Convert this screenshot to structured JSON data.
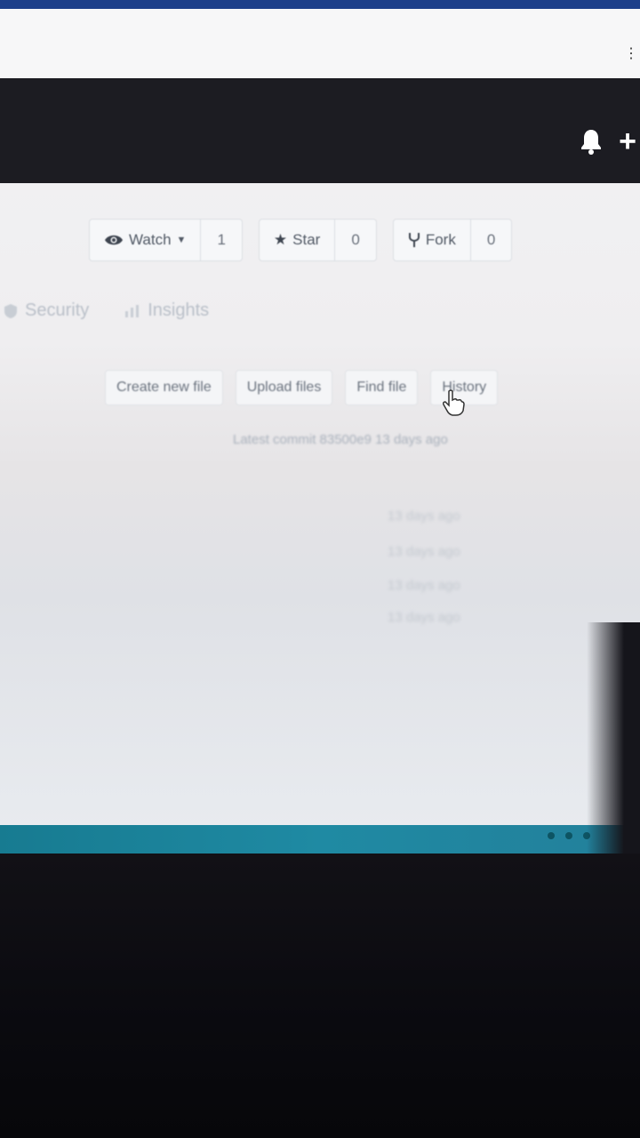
{
  "repo_actions": {
    "watch_label": "Watch",
    "watch_count": "1",
    "star_label": "Star",
    "star_count": "0",
    "fork_label": "Fork",
    "fork_count": "0"
  },
  "nav": {
    "tabs": [
      {
        "label": "Security",
        "icon": "shield-icon"
      },
      {
        "label": "Insights",
        "icon": "graph-icon"
      }
    ]
  },
  "file_actions": {
    "create_new_file": "Create new file",
    "upload_files": "Upload files",
    "find_file": "Find file",
    "history": "History"
  },
  "latest_commit": "Latest commit 83500e9 13 days ago",
  "commit_times": [
    "13 days ago",
    "13 days ago",
    "13 days ago",
    "13 days ago"
  ],
  "colors": {
    "header": "#1c1c22",
    "taskbar": "#1f8aa3"
  }
}
